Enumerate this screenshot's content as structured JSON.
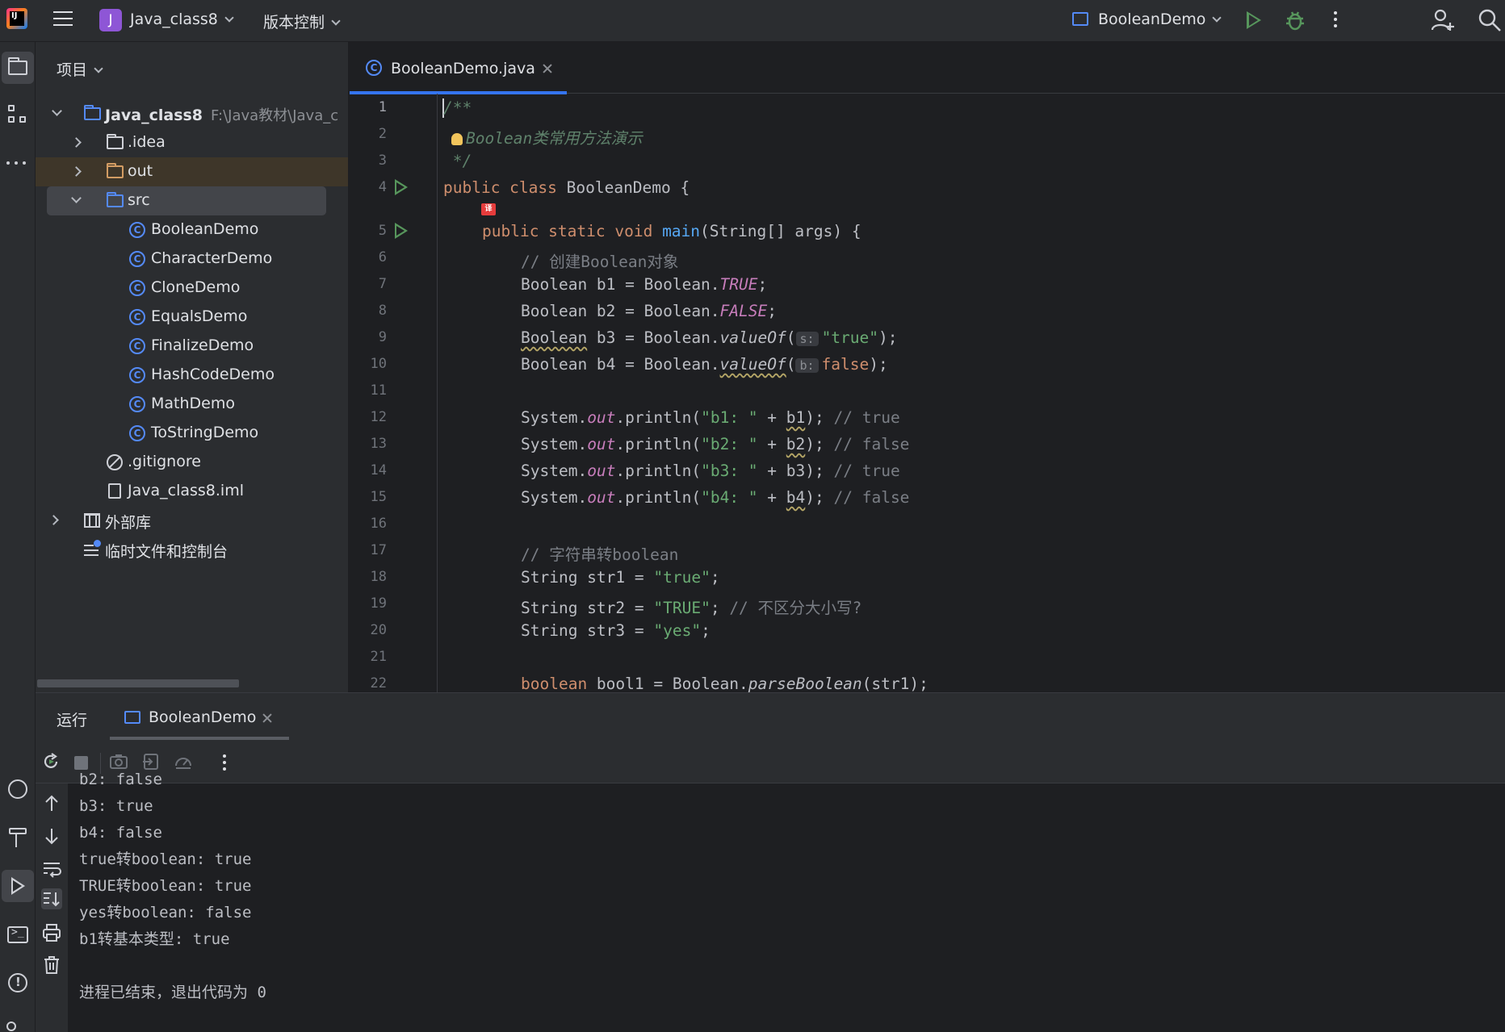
{
  "titlebar": {
    "logo_text": "IJ",
    "project_badge": "J",
    "project_name": "Java_class8",
    "vcs_menu": "版本控制",
    "run_config": "BooleanDemo"
  },
  "project_panel": {
    "header": "项目",
    "root": {
      "name": "Java_class8",
      "path": "F:\\Java教材\\Java_c"
    },
    "items": [
      {
        "name": ".idea"
      },
      {
        "name": "out"
      },
      {
        "name": "src"
      },
      {
        "name": "BooleanDemo"
      },
      {
        "name": "CharacterDemo"
      },
      {
        "name": "CloneDemo"
      },
      {
        "name": "EqualsDemo"
      },
      {
        "name": "FinalizeDemo"
      },
      {
        "name": "HashCodeDemo"
      },
      {
        "name": "MathDemo"
      },
      {
        "name": "ToStringDemo"
      },
      {
        "name": ".gitignore"
      },
      {
        "name": "Java_class8.iml"
      },
      {
        "name": "外部库"
      },
      {
        "name": "临时文件和控制台"
      }
    ]
  },
  "editor": {
    "tab_label": "BooleanDemo.java",
    "cn_badge": "译",
    "line_numbers": [
      "1",
      "2",
      "3",
      "4",
      "5",
      "6",
      "7",
      "8",
      "9",
      "10",
      "11",
      "12",
      "13",
      "14",
      "15",
      "16",
      "17",
      "18",
      "19",
      "20",
      "21",
      "22"
    ],
    "lines": {
      "l1": "/**",
      "l2_doc": "Boolean类常用方法演示",
      "l3": " */",
      "l4_kw": "public class ",
      "l4_rest": "BooleanDemo {",
      "l5_kw": "public static void ",
      "l5_fn": "main",
      "l5_rest": "(String[] args) {",
      "l6": "// 创建Boolean对象",
      "l7_a": "Boolean b1 = Boolean.",
      "l7_b": "TRUE",
      "l8_a": "Boolean b2 = Boolean.",
      "l8_b": "FALSE",
      "l9_a": "Boolean",
      "l9_b": " b3 = Boolean.",
      "l9_c": "valueOf",
      "l9_hint": "s:",
      "l9_s": "\"true\"",
      "l10_a": "Boolean b4 = Boolean.",
      "l10_c": "valueOf",
      "l10_hint": "b:",
      "l10_k": "false",
      "l12_arg": "\"b1: \"",
      "l12_var": "b1",
      "l12_cm": "// true",
      "l13_arg": "\"b2: \"",
      "l13_var": "b2",
      "l13_cm": "// false",
      "l14_arg": "\"b3: \"",
      "l14_var": "b3",
      "l14_cm": "// true",
      "l15_arg": "\"b4: \"",
      "l15_var": "b4",
      "l15_cm": "// false",
      "sys": "System.",
      "out": "out",
      "println": ".println(",
      "plus": " + ",
      "close": "); ",
      "l17": "// 字符串转boolean",
      "l18_a": "String str1 = ",
      "l18_s": "\"true\"",
      "l19_a": "String str2 = ",
      "l19_s": "\"TRUE\"",
      "l19_cm": "// 不区分大小写?",
      "l20_a": "String str3 = ",
      "l20_s": "\"yes\"",
      "l22_k": "boolean",
      "l22_a": " bool1 = Boolean.",
      "l22_fn": "parseBoolean",
      "l22_b": "(str1);"
    }
  },
  "run_panel": {
    "title": "运行",
    "tab_label": "BooleanDemo",
    "console": [
      "b2: false",
      "b3: true",
      "b4: false",
      "true转boolean: true",
      "TRUE转boolean: true",
      "yes转boolean: false",
      "b1转基本类型: true",
      "",
      "进程已结束，退出代码为 0"
    ]
  },
  "colors": {
    "keyword": "#cf8e6d",
    "string": "#6aab73",
    "function": "#56a8f5",
    "static_field": "#c77dbb",
    "comment": "#7a7e85",
    "accent": "#3574f0"
  }
}
